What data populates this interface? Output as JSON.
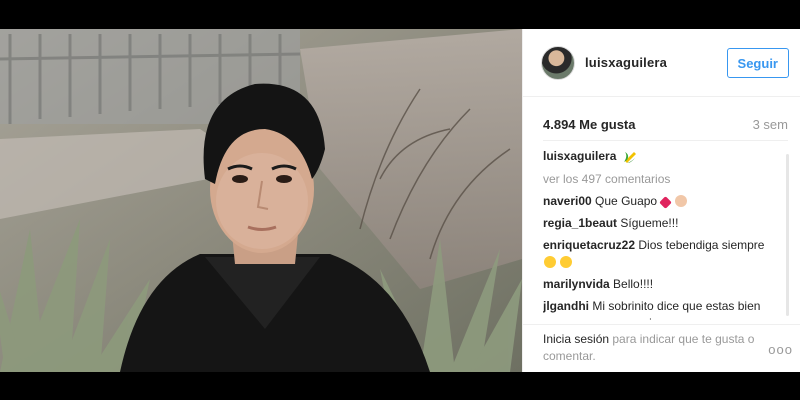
{
  "post": {
    "author": "luisxaguilera",
    "follow_label": "Seguir",
    "likes": "4.894 Me gusta",
    "age": "3 sem",
    "view_comments": "ver los 497 comentarios",
    "caption_icon": "corn-cob-icon"
  },
  "comments": [
    {
      "user": "naveri00",
      "text": "Que Guapo"
    },
    {
      "user": "regia_1beaut",
      "text": "Sígueme!!!"
    },
    {
      "user": "enriquetacruz22",
      "text": "Dios tebendiga siempre"
    },
    {
      "user": "marilynvida",
      "text": "Bello!!!!"
    },
    {
      "user": "jlgandhi",
      "text": "Mi sobrinito dice que estas bien guapo, ya me sonroje"
    }
  ],
  "footer": {
    "login_label": "Inicia sesión",
    "login_suffix": " para indicar que te gusta o comentar.",
    "more_options": "ooo"
  },
  "colors": {
    "accent": "#3897f0",
    "muted": "#999999",
    "text": "#262626"
  }
}
